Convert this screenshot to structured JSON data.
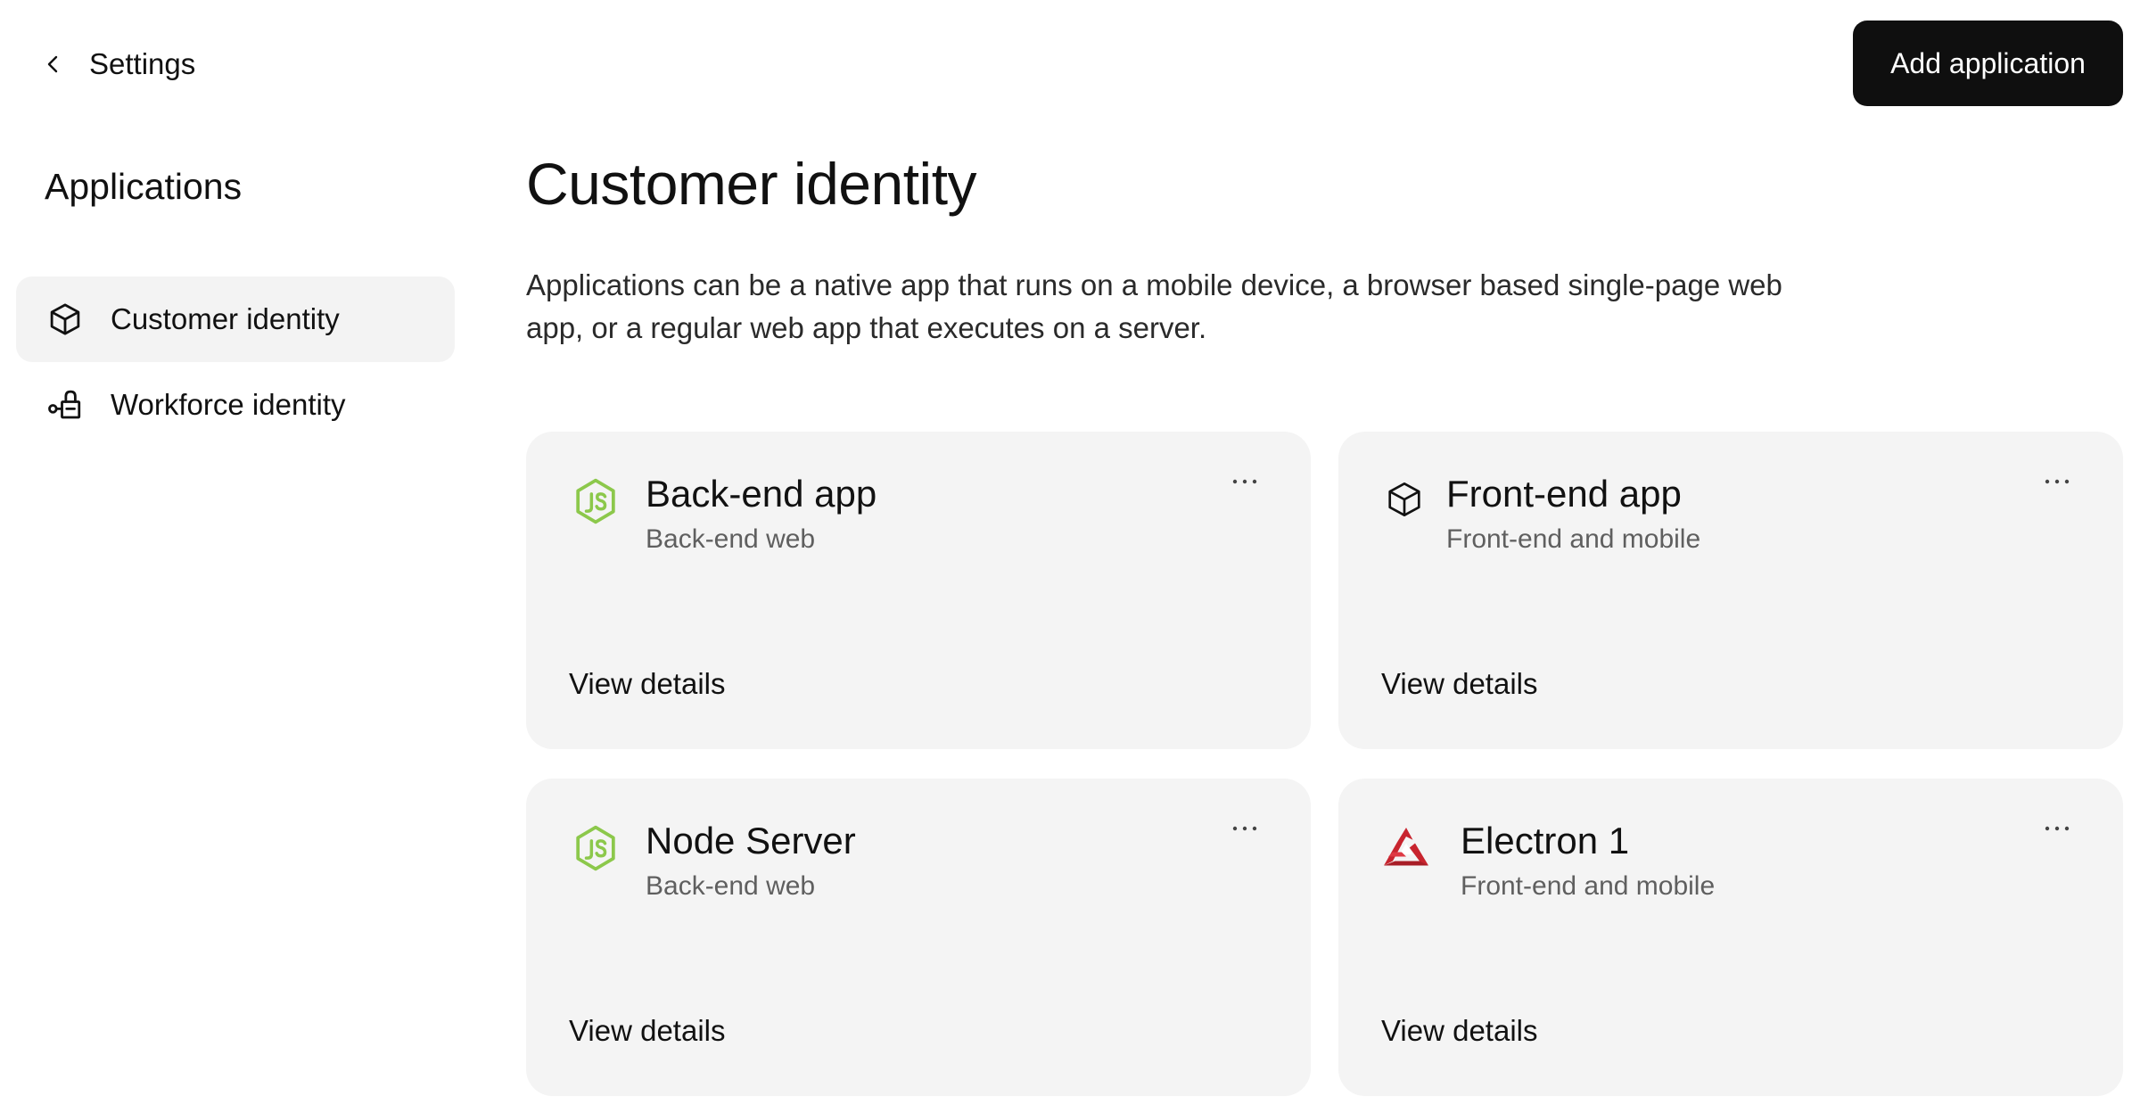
{
  "header": {
    "back_label": "Settings",
    "add_button_label": "Add application"
  },
  "sidebar": {
    "title": "Applications",
    "items": [
      {
        "label": "Customer identity",
        "icon": "cube-icon",
        "active": true
      },
      {
        "label": "Workforce identity",
        "icon": "workforce-icon",
        "active": false
      }
    ]
  },
  "main": {
    "title": "Customer identity",
    "description": "Applications can be a native app that runs on a mobile device, a browser based single-page web app, or a regular web app that executes on a server.",
    "apps": [
      {
        "name": "Back-end app",
        "type": "Back-end web",
        "icon": "nodejs-icon",
        "link": "View details"
      },
      {
        "name": "Front-end app",
        "type": "Front-end and mobile",
        "icon": "cube-icon",
        "link": "View details"
      },
      {
        "name": "Node Server",
        "type": "Back-end web",
        "icon": "nodejs-icon",
        "link": "View details"
      },
      {
        "name": "Electron 1",
        "type": "Front-end and mobile",
        "icon": "electron-icon",
        "link": "View details"
      }
    ]
  },
  "colors": {
    "primary_button": "#0f0f0f",
    "card_background": "#f4f4f4",
    "active_nav_background": "#f3f3f3",
    "nodejs_green": "#8cc84b",
    "electron_red": "#c8242e"
  }
}
